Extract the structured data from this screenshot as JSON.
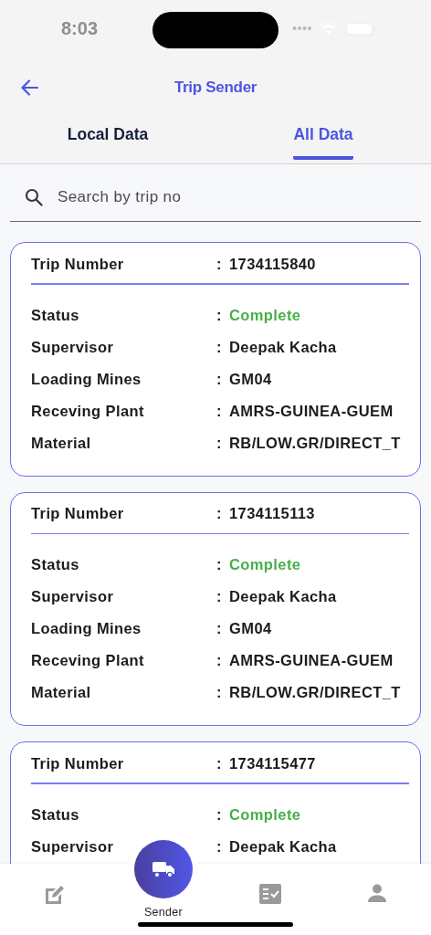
{
  "status_bar": {
    "time": "8:03"
  },
  "header": {
    "title": "Trip Sender"
  },
  "tabs": [
    {
      "label": "Local Data",
      "selected": false
    },
    {
      "label": "All Data",
      "selected": true
    }
  ],
  "search": {
    "placeholder": "Search by trip no"
  },
  "trips": [
    {
      "trip_label": "Trip Number",
      "separator": ":",
      "trip_number": "1734115840",
      "rows": [
        {
          "label": "Status",
          "separator": ":",
          "value": "Complete",
          "kind": "status"
        },
        {
          "label": "Supervisor",
          "separator": ":",
          "value": "Deepak  Kacha",
          "kind": "text"
        },
        {
          "label": "Loading Mines",
          "separator": ":",
          "value": "GM04",
          "kind": "text"
        },
        {
          "label": "Receving Plant",
          "separator": ":",
          "value": "AMRS-GUINEA-GUEM",
          "kind": "text"
        },
        {
          "label": "Material",
          "separator": ":",
          "value": "RB/LOW.GR/DIRECT_T",
          "kind": "text"
        }
      ]
    },
    {
      "trip_label": "Trip Number",
      "separator": ":",
      "trip_number": "1734115113",
      "rows": [
        {
          "label": "Status",
          "separator": ":",
          "value": "Complete",
          "kind": "status"
        },
        {
          "label": "Supervisor",
          "separator": ":",
          "value": "Deepak  Kacha",
          "kind": "text"
        },
        {
          "label": "Loading Mines",
          "separator": ":",
          "value": "GM04",
          "kind": "text"
        },
        {
          "label": "Receving Plant",
          "separator": ":",
          "value": "AMRS-GUINEA-GUEM",
          "kind": "text"
        },
        {
          "label": "Material",
          "separator": ":",
          "value": "RB/LOW.GR/DIRECT_T",
          "kind": "text"
        }
      ]
    },
    {
      "trip_label": "Trip Number",
      "separator": ":",
      "trip_number": "1734115477",
      "rows": [
        {
          "label": "Status",
          "separator": ":",
          "value": "Complete",
          "kind": "status"
        },
        {
          "label": "Supervisor",
          "separator": ":",
          "value": "Deepak  Kacha",
          "kind": "text"
        }
      ]
    }
  ],
  "bottom_nav": [
    {
      "kind": "edit",
      "selected": false
    },
    {
      "kind": "truck",
      "label": "Sender",
      "selected": true
    },
    {
      "kind": "checklist",
      "selected": false
    },
    {
      "kind": "person",
      "selected": false
    }
  ]
}
